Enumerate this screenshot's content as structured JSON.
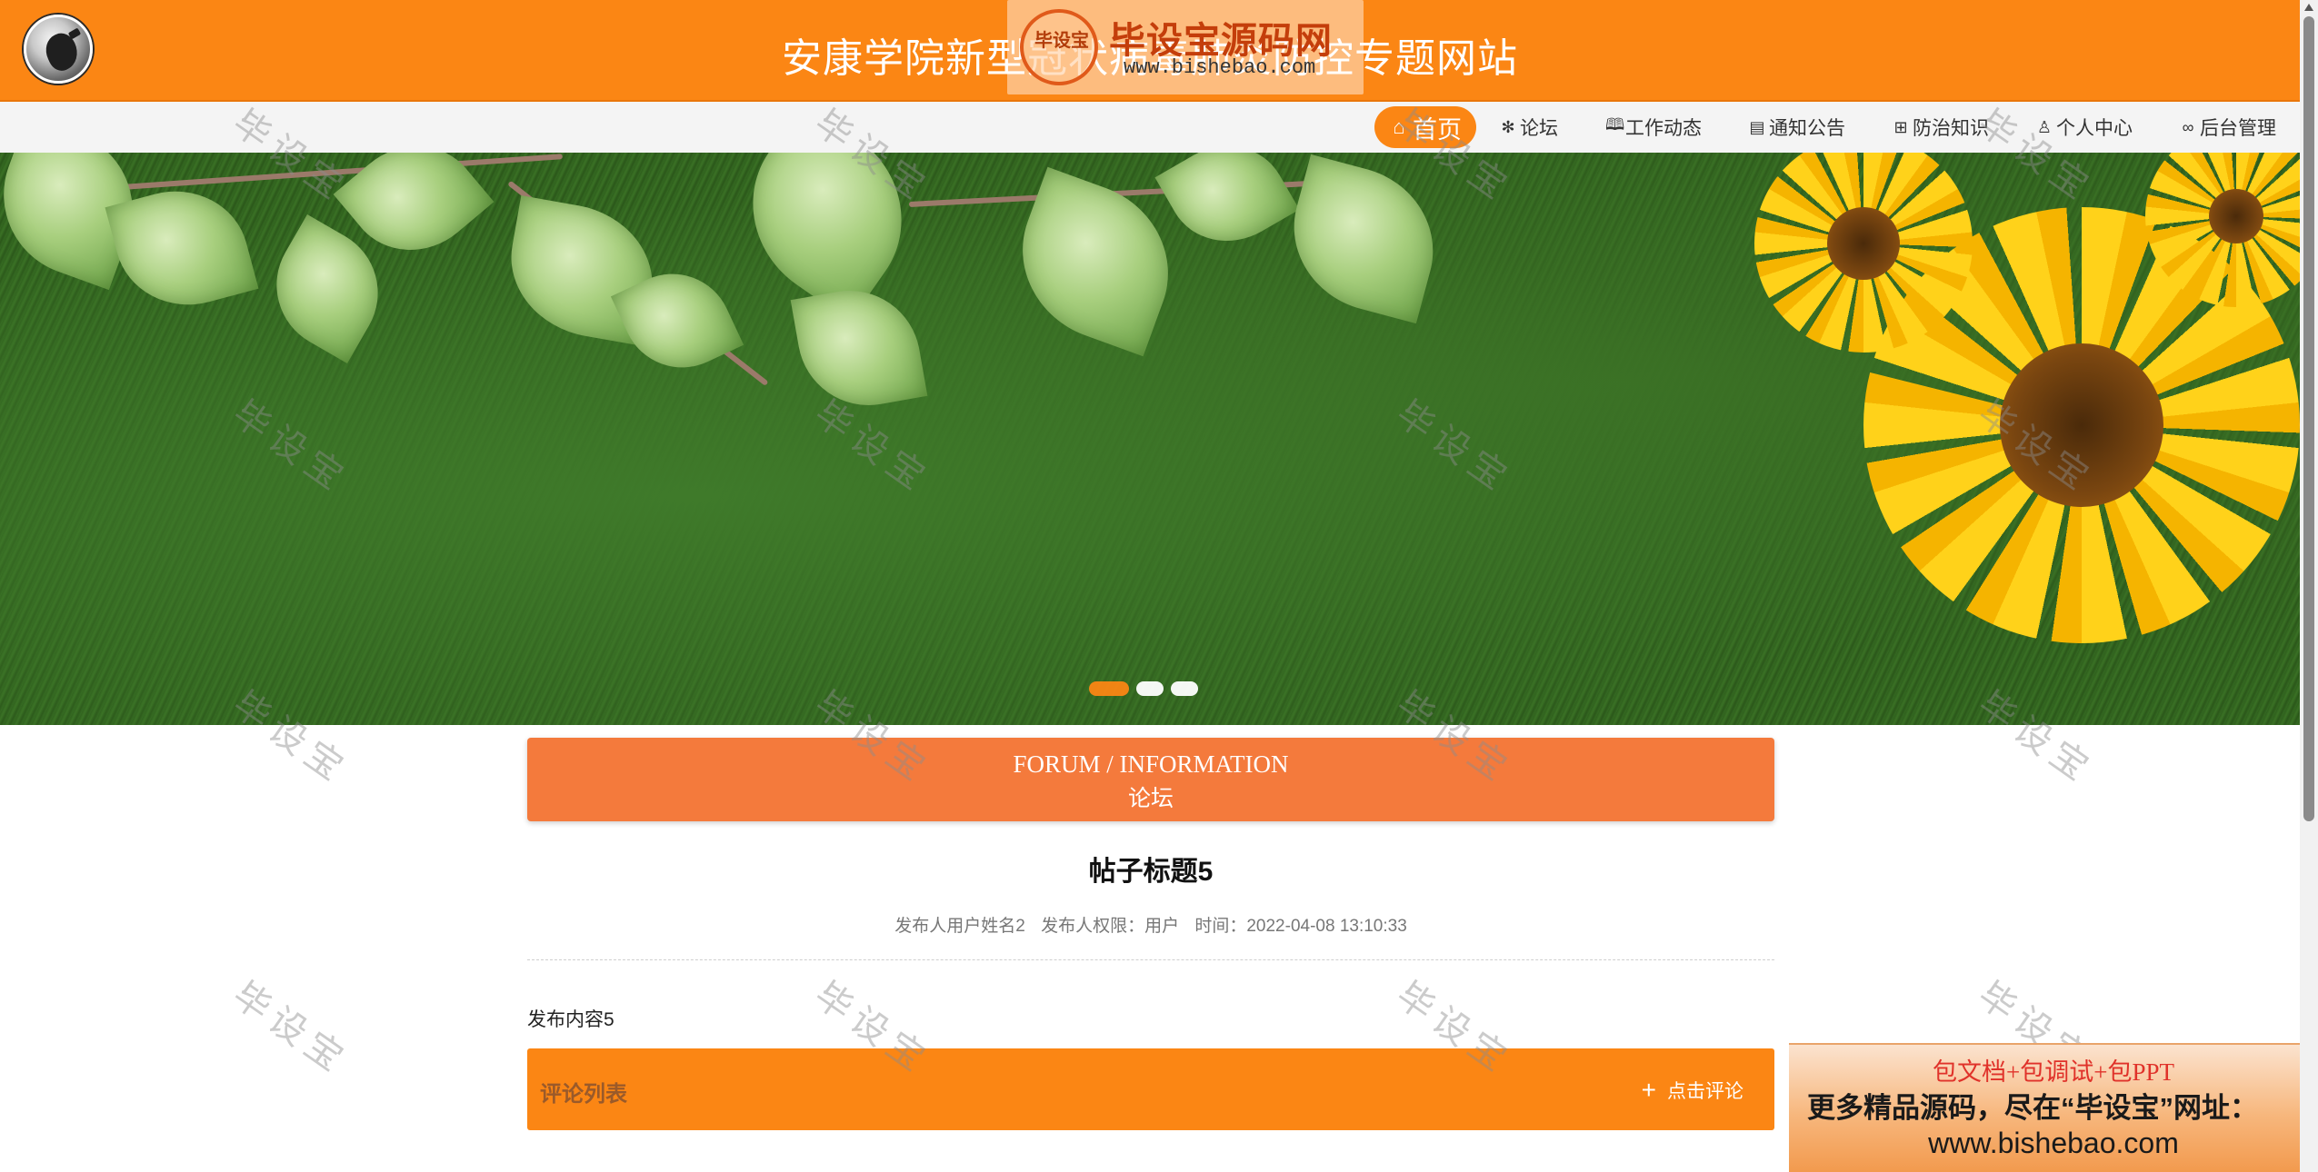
{
  "header": {
    "title": "安康学院新型冠状病毒肺炎防控专题网站",
    "brand_color": "#fb8614"
  },
  "watermark_brand": {
    "seal_text": "毕设宝",
    "name": "毕设宝源码网",
    "url": "www.bishebao.com"
  },
  "watermark_text": "毕设宝",
  "nav": {
    "items": [
      {
        "label": "首页",
        "icon": "home-icon",
        "active": true
      },
      {
        "label": "论坛",
        "icon": "asterisk-icon",
        "active": false
      },
      {
        "label": "工作动态",
        "icon": "book-icon",
        "active": false
      },
      {
        "label": "通知公告",
        "icon": "document-icon",
        "active": false
      },
      {
        "label": "防治知识",
        "icon": "grid-icon",
        "active": false
      },
      {
        "label": "个人中心",
        "icon": "user-icon",
        "active": false
      },
      {
        "label": "后台管理",
        "icon": "link-icon",
        "active": false
      }
    ]
  },
  "banner": {
    "slides": 3,
    "active_slide": 1
  },
  "section": {
    "en": "FORUM / INFORMATION",
    "cn": "论坛"
  },
  "post": {
    "title": "帖子标题5",
    "author": "发布人用户姓名2",
    "role": "发布人权限：用户",
    "time": "时间：2022-04-08 13:10:33",
    "content": "发布内容5"
  },
  "comments": {
    "label": "评论列表",
    "add_label": "点击评论"
  },
  "ad": {
    "line1": "包文档+包调试+包PPT",
    "line2": "更多精品源码，尽在“毕设宝”网址：",
    "line3": "www.bishebao.com"
  }
}
